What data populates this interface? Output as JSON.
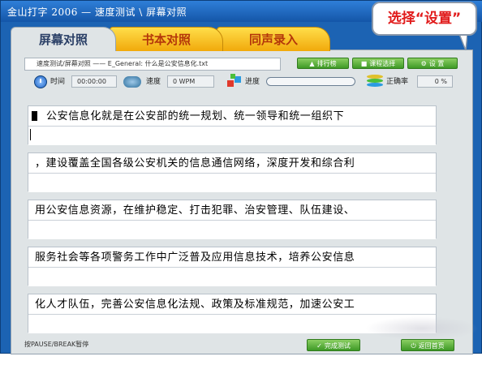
{
  "window": {
    "title": "金山打字 2006 — 速度测试 \\ 屏幕对照"
  },
  "tabs": [
    {
      "label": "屏幕对照",
      "active": true
    },
    {
      "label": "书本对照",
      "active": false
    },
    {
      "label": "同声录入",
      "active": false
    }
  ],
  "path_text": "速度测试/屏幕对照 —— E_General: 什么是公安信息化.txt",
  "toolbar": {
    "rank_label": "排行榜",
    "course_label": "课程选择",
    "settings_label": "设 置"
  },
  "status": {
    "time_label": "时间",
    "time_value": "00:00:00",
    "speed_label": "速度",
    "speed_value": "0 WPM",
    "progress_label": "进度",
    "progress_fraction": 0.0,
    "accuracy_label": "正确率",
    "accuracy_value": "0 %"
  },
  "lines": [
    "公安信息化就是在公安部的统一规划、统一领导和统一组织下",
    "，建设覆盖全国各级公安机关的信息通信网络，深度开发和综合利",
    "用公安信息资源，在维护稳定、打击犯罪、治安管理、队伍建设、",
    "服务社会等各项警务工作中广泛普及应用信息技术，培养公安信息",
    "化人才队伍，完善公安信息化法规、政策及标准规范，加速公安工"
  ],
  "footer": {
    "hint": "按PAUSE/BREAK暂停",
    "finish_label": "完成测试",
    "back_label": "返回首页"
  },
  "callout_text": "选择“设置”",
  "colors": {
    "frame": "#1c63b3",
    "tab_active": "#dfe4e6",
    "tab_inactive": "#f1a90b",
    "button_green": "#3e9a26",
    "callout_text": "#e11c1c"
  }
}
